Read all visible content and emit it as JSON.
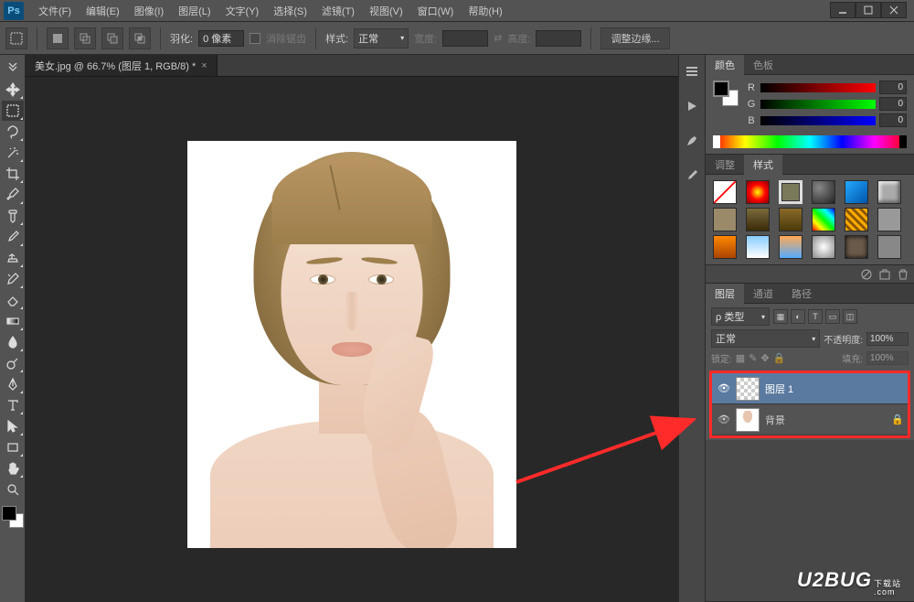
{
  "menu": {
    "file": "文件(F)",
    "edit": "编辑(E)",
    "image": "图像(I)",
    "layer": "图层(L)",
    "type": "文字(Y)",
    "select": "选择(S)",
    "filter": "滤镜(T)",
    "view": "视图(V)",
    "window": "窗口(W)",
    "help": "帮助(H)"
  },
  "options": {
    "feather_label": "羽化:",
    "feather_value": "0 像素",
    "antialias": "消除锯齿",
    "style_label": "样式:",
    "style_value": "正常",
    "width_label": "宽度:",
    "height_label": "高度:",
    "refine_edge": "调整边缘..."
  },
  "doc": {
    "tab_title": "美女.jpg @ 66.7% (图层 1, RGB/8) *"
  },
  "panels": {
    "color_tab": "颜色",
    "swatches_tab": "色板",
    "r_label": "R",
    "g_label": "G",
    "b_label": "B",
    "r_val": "0",
    "g_val": "0",
    "b_val": "0",
    "adjust_tab": "调整",
    "styles_tab": "样式",
    "layers_tab": "图层",
    "channels_tab": "通道",
    "paths_tab": "路径",
    "kind_label": "类型",
    "blend_mode": "正常",
    "opacity_label": "不透明度:",
    "opacity_val": "100%",
    "fill_label": "填充:",
    "fill_val": "100%",
    "lock_label": "锁定:",
    "layer1_name": "图层 1",
    "bg_layer_name": "背景"
  },
  "watermark": {
    "text": "U2BUG",
    "sub1": "下载站",
    "sub2": ".com"
  }
}
